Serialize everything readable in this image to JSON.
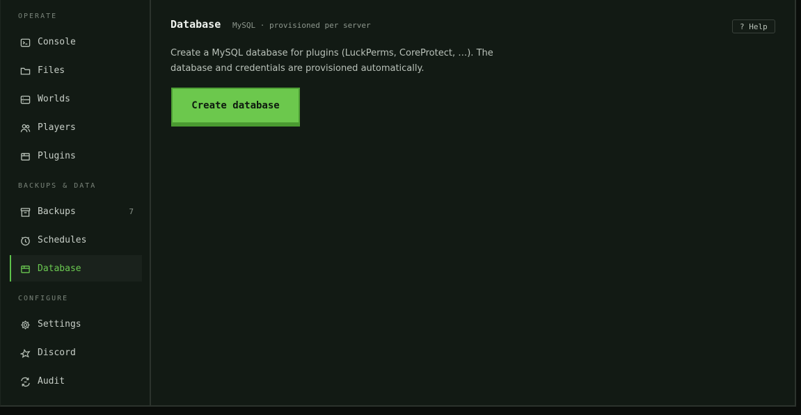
{
  "sidebar": {
    "groups": [
      {
        "title": "OPERATE",
        "items": [
          {
            "label": "Console",
            "icon": "terminal-icon"
          },
          {
            "label": "Files",
            "icon": "folder-icon"
          },
          {
            "label": "Worlds",
            "icon": "server-icon"
          },
          {
            "label": "Players",
            "icon": "users-icon"
          },
          {
            "label": "Plugins",
            "icon": "package-icon"
          }
        ]
      },
      {
        "title": "BACKUPS & DATA",
        "items": [
          {
            "label": "Backups",
            "icon": "archive-icon",
            "count": "7"
          },
          {
            "label": "Schedules",
            "icon": "clock-icon"
          },
          {
            "label": "Database",
            "icon": "database-icon",
            "active": true
          }
        ]
      },
      {
        "title": "CONFIGURE",
        "items": [
          {
            "label": "Settings",
            "icon": "gear-icon"
          },
          {
            "label": "Discord",
            "icon": "discord-icon"
          },
          {
            "label": "Audit",
            "icon": "audit-icon"
          }
        ]
      }
    ]
  },
  "main": {
    "title": "Database",
    "subtitle": "MySQL · provisioned per server",
    "help_label": "? Help",
    "description": "Create a MySQL database for plugins (LuckPerms, CoreProtect, …). The database and credentials are provisioned automatically.",
    "create_button_label": "Create database"
  },
  "colors": {
    "accent": "#6cc84d",
    "background": "#121a14",
    "active_text": "#6bc951"
  }
}
